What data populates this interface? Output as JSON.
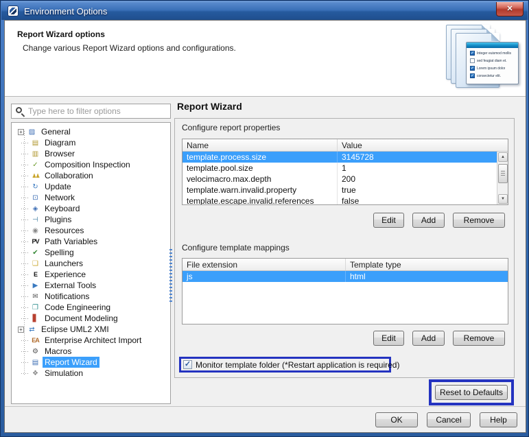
{
  "window": {
    "title": "Environment Options",
    "close_glyph": "✕"
  },
  "header": {
    "title": "Report Wizard options",
    "description": "Change various Report Wizard options and configurations.",
    "checklist_graphic": [
      {
        "text": "Integer euismod mollis",
        "checked": true
      },
      {
        "text": "sed feugiat diam et.",
        "checked": false
      },
      {
        "text": "Lorem ipsum dolor",
        "checked": true
      },
      {
        "text": "consectetur elit.",
        "checked": true
      }
    ],
    "check_glyph": "✓"
  },
  "filter": {
    "placeholder": "Type here to filter options"
  },
  "tree": {
    "items": [
      {
        "label": "General",
        "icon": "general-icon",
        "char": "▨",
        "color": "#3f6fb5",
        "expandable": true
      },
      {
        "label": "Diagram",
        "icon": "diagram-icon",
        "char": "▤",
        "color": "#b0972f"
      },
      {
        "label": "Browser",
        "icon": "browser-icon",
        "char": "▥",
        "color": "#b0972f"
      },
      {
        "label": "Composition Inspection",
        "icon": "composition-inspection-icon",
        "char": "✓",
        "color": "#6f9c2f"
      },
      {
        "label": "Collaboration",
        "icon": "collaboration-icon",
        "char": "♟♟",
        "color": "#c8a42a",
        "small": true
      },
      {
        "label": "Update",
        "icon": "update-icon",
        "char": "↻",
        "color": "#3a7ac0"
      },
      {
        "label": "Network",
        "icon": "network-icon",
        "char": "⊡",
        "color": "#3f6fb5"
      },
      {
        "label": "Keyboard",
        "icon": "keyboard-icon",
        "char": "◈",
        "color": "#3f6fb5"
      },
      {
        "label": "Plugins",
        "icon": "plugins-icon",
        "char": "⊣",
        "color": "#3a7a9f"
      },
      {
        "label": "Resources",
        "icon": "resources-icon",
        "char": "◉",
        "color": "#8a8a8a"
      },
      {
        "label": "Path Variables",
        "icon": "path-variables-icon",
        "char": "PV",
        "color": "#111111",
        "txt": true
      },
      {
        "label": "Spelling",
        "icon": "spelling-icon",
        "char": "✔",
        "color": "#3a8a3a"
      },
      {
        "label": "Launchers",
        "icon": "launchers-icon",
        "char": "❏",
        "color": "#c8a42a"
      },
      {
        "label": "Experience",
        "icon": "experience-icon",
        "char": "E",
        "color": "#111111",
        "txt": true
      },
      {
        "label": "External Tools",
        "icon": "external-tools-icon",
        "char": "▶",
        "color": "#3a7ac0"
      },
      {
        "label": "Notifications",
        "icon": "notifications-icon",
        "char": "✉",
        "color": "#555555"
      },
      {
        "label": "Code Engineering",
        "icon": "code-engineering-icon",
        "char": "❐",
        "color": "#2a8a8a"
      },
      {
        "label": "Document Modeling",
        "icon": "document-modeling-icon",
        "char": "▋",
        "color": "#b84030"
      },
      {
        "label": "Eclipse UML2 XMI",
        "icon": "eclipse-uml2-xmi-icon",
        "char": "⇄",
        "color": "#3a7ac0",
        "expandable": true
      },
      {
        "label": "Enterprise Architect Import",
        "icon": "enterprise-architect-import-icon",
        "char": "EA",
        "color": "#b06a2a",
        "txt": true
      },
      {
        "label": "Macros",
        "icon": "macros-icon",
        "char": "⚙",
        "color": "#555555"
      },
      {
        "label": "Report Wizard",
        "icon": "report-wizard-icon",
        "char": "▤",
        "color": "#3f6fb5",
        "selected": true
      },
      {
        "label": "Simulation",
        "icon": "simulation-icon",
        "char": "❖",
        "color": "#888888"
      }
    ],
    "expander_glyph": "+"
  },
  "panel": {
    "title": "Report Wizard",
    "properties": {
      "label": "Configure report properties",
      "columns": [
        "Name",
        "Value"
      ],
      "rows": [
        {
          "name": "template.process.size",
          "value": "3145728",
          "selected": true
        },
        {
          "name": "template.pool.size",
          "value": "1"
        },
        {
          "name": "velocimacro.max.depth",
          "value": "200"
        },
        {
          "name": "template.warn.invalid.property",
          "value": "true"
        },
        {
          "name": "template.escape.invalid.references",
          "value": "false",
          "clipped": true
        }
      ]
    },
    "mappings": {
      "label": "Configure template mappings",
      "columns": [
        "File extension",
        "Template type"
      ],
      "rows": [
        {
          "name": "js",
          "value": "html",
          "selected": true
        }
      ]
    },
    "action_buttons": [
      "Edit",
      "Add",
      "Remove"
    ],
    "monitor_checkbox": {
      "label": "Monitor template folder (*Restart application is required)",
      "checked": true,
      "check_glyph": "✓"
    },
    "reset_button": "Reset to Defaults",
    "scrollbar": {
      "up_glyph": "▲",
      "down_glyph": "▼"
    }
  },
  "footer": {
    "buttons": [
      "OK",
      "Cancel",
      "Help"
    ]
  },
  "colors": {
    "selection": "#3b9ffb",
    "highlight_border": "#2433c0",
    "titlebar": "#2f66ad"
  }
}
